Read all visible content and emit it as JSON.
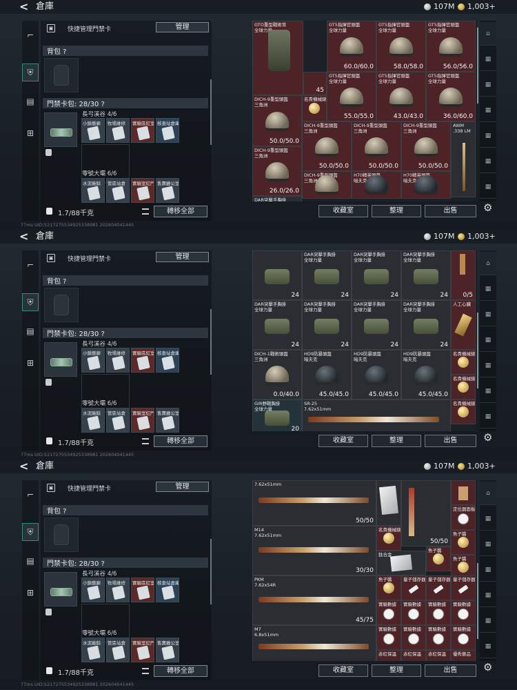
{
  "header": {
    "back_label": "<",
    "title": "倉庫",
    "silver": "107M",
    "gold": "1,003+"
  },
  "left": {
    "keycard_mgr_label": "快捷管理門禁卡",
    "keycard_mgr_q": "?",
    "manage_button": "管理",
    "backpack_label": "背包 ?",
    "keycard_bag_label": "門禁卡包: 28/30 ?",
    "group1_title": "長弓溪谷 4/6",
    "group1_slots": [
      "小鎮藝廊",
      "牧場維修",
      "實驗區紅室",
      "核查站倉庫"
    ],
    "group2_title": "零號大壩 6/6",
    "group2_slots": [
      "水泥廠餘",
      "管區站倉",
      "實驗室紅門",
      "售賣廳公室"
    ],
    "weight": "1.7/88千克",
    "transfer_all": "轉移全部"
  },
  "right_buttons": {
    "collection": "收藏室",
    "sort": "整理",
    "sell": "出售"
  },
  "trail_text": "77ms UID:5217275534925338981 202604041445",
  "panel1": {
    "gto": "GTO重型戰術背",
    "global": "全球力量",
    "gt5": "GT5指揮官頭盔",
    "gt5_durs": [
      "60.0/60.0",
      "58.0/58.0",
      "56.0/56.0"
    ],
    "gt5b_durs": [
      "55.0/55.0",
      "43.0/43.0",
      "36.0/60.0"
    ],
    "count45": "45",
    "watch": "名貴機械錶",
    "dich9": "DICH-9重型頭盔",
    "triangle": "三角洲",
    "dich_durs": [
      "50.0/50.0",
      "50.0/50.0",
      "50.0/50.0",
      "50.0/50.0"
    ],
    "awm": "AWM",
    "awm_cal": ".338 LM",
    "dich_last": "26.0/26.0",
    "h70": "H70精英頭盔",
    "h70_sub": "暗夫克",
    "dar": "DAR突擊手胸掛"
  },
  "panel2": {
    "dar": "DAR突擊手胸掛",
    "global": "全球力量",
    "count24": "24",
    "zero5": "0/5",
    "ai_heart": "人工心臟",
    "dich1": "DICH-1戰術頭盔",
    "triangle": "三角洲",
    "dich1_dur": "0.0/40.0",
    "hd9": "HD9防暴頭盔",
    "hd9_sub": "暗夫克",
    "hd9_durs": [
      "45.0/45.0",
      "45.0/45.0",
      "45.0/45.0"
    ],
    "gir": "GIR野戰胸掛",
    "count20": "20",
    "sr25": "SR-25",
    "sr25_cal": "7.62x51mm",
    "watch": "名貴機械錶"
  },
  "panel3": {
    "cal1": "7.62x51mm",
    "dur1": "50/50",
    "m14": "M14",
    "m14_cal": "7.62x51mm",
    "dur2": "30/30",
    "pkm": "PKM",
    "pkm_cal": "7.62x54R",
    "dur3": "45/75",
    "m7": "M7",
    "m7_cal": "6.8x51mm",
    "dur_small": "50/50",
    "watch": "名貴機械錶",
    "ti": "鈦合金",
    "quant": "量子儲存器",
    "dr": "實驗數據",
    "locator": "定位器面板",
    "scale": "魚子醬",
    "redzone": "赤紅保溫",
    "pinfo": "優秀藝品"
  }
}
